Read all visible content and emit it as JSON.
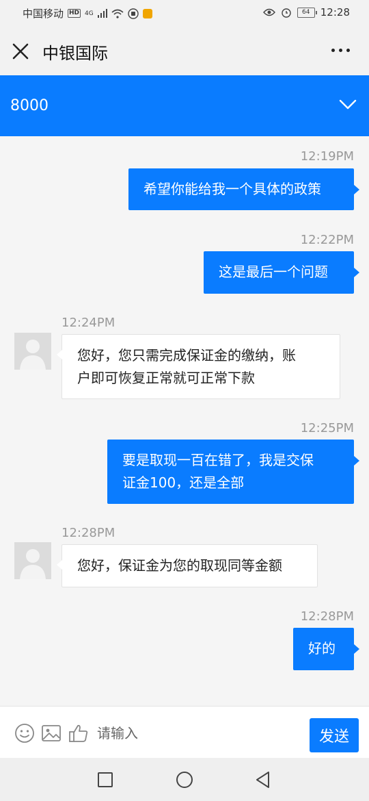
{
  "status": {
    "carrier": "中国移动",
    "hd": "HD",
    "network": "4G",
    "battery": "64",
    "time": "12:28"
  },
  "titlebar": {
    "title": "中银国际",
    "close_icon": "close-icon",
    "more_icon": "more-icon"
  },
  "header": {
    "number": "8000",
    "chevron_icon": "chevron-down-icon"
  },
  "messages": [
    {
      "direction": "out",
      "time": "12:19PM",
      "text": "希望你能给我一个具体的政策"
    },
    {
      "direction": "out",
      "time": "12:22PM",
      "text": "这是最后一个问题"
    },
    {
      "direction": "in",
      "time": "12:24PM",
      "line1": "您好，您只需完成保证金的缴纳，账",
      "line2": "户即可恢复正常就可正常下款"
    },
    {
      "direction": "out",
      "time": "12:25PM",
      "line1": "要是取现一百在错了，我是交保",
      "line2": "证金100，还是全部"
    },
    {
      "direction": "in",
      "time": "12:28PM",
      "text": "您好，保证金为您的取现同等金额"
    },
    {
      "direction": "out",
      "time": "12:28PM",
      "text": "好的"
    }
  ],
  "input": {
    "placeholder": "请输入",
    "send_label": "发送"
  },
  "colors": {
    "accent": "#0a7cff",
    "background": "#f5f5f5"
  }
}
